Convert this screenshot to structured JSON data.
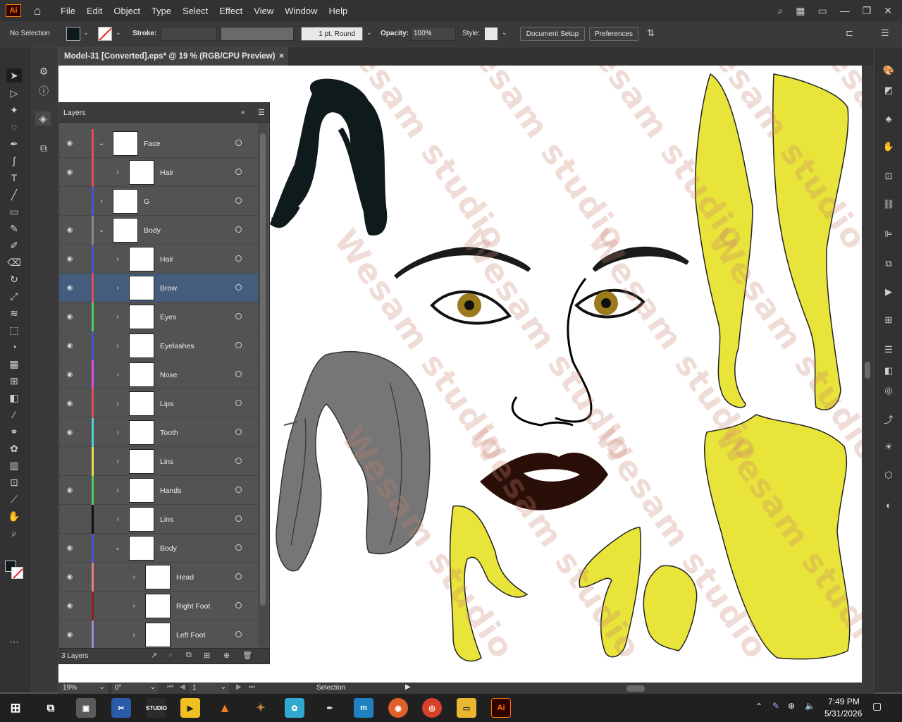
{
  "app": {
    "logo": "Ai",
    "menus": [
      "File",
      "Edit",
      "Object",
      "Type",
      "Select",
      "Effect",
      "View",
      "Window",
      "Help"
    ]
  },
  "controlbar": {
    "selection_status": "No Selection",
    "stroke_label": "Stroke:",
    "stroke_profile": "1 pt. Round",
    "opacity_label": "Opacity:",
    "opacity_value": "100%",
    "style_label": "Style:",
    "document_setup": "Document Setup",
    "preferences": "Preferences"
  },
  "document": {
    "tab_title": "Model-31 [Converted].eps* @ 19 % (RGB/CPU Preview)",
    "close_symbol": "×"
  },
  "layers_panel": {
    "title": "Layers",
    "footer_count": "3 Layers",
    "rows": [
      {
        "name": "Face",
        "color": "#e05050",
        "indent": 0,
        "expanded": true,
        "visible": true,
        "selected": false
      },
      {
        "name": "Hair",
        "color": "#e05050",
        "indent": 1,
        "expanded": false,
        "visible": true,
        "selected": false
      },
      {
        "name": "G",
        "color": "#5050d0",
        "indent": 0,
        "expanded": false,
        "visible": false,
        "selected": false
      },
      {
        "name": "Body",
        "color": "#888888",
        "indent": 0,
        "expanded": true,
        "visible": true,
        "selected": false
      },
      {
        "name": "Hair",
        "color": "#5050d0",
        "indent": 1,
        "expanded": false,
        "visible": true,
        "selected": false
      },
      {
        "name": "Brow",
        "color": "#e05050",
        "indent": 1,
        "expanded": false,
        "visible": true,
        "selected": true
      },
      {
        "name": "Eyes",
        "color": "#50d050",
        "indent": 1,
        "expanded": false,
        "visible": true,
        "selected": false
      },
      {
        "name": "Eyelashes",
        "color": "#5050d0",
        "indent": 1,
        "expanded": false,
        "visible": true,
        "selected": false
      },
      {
        "name": "Nose",
        "color": "#e050e0",
        "indent": 1,
        "expanded": false,
        "visible": true,
        "selected": false
      },
      {
        "name": "Lips",
        "color": "#e05050",
        "indent": 1,
        "expanded": false,
        "visible": true,
        "selected": false
      },
      {
        "name": "Tooth",
        "color": "#50d0d0",
        "indent": 1,
        "expanded": false,
        "visible": true,
        "selected": false
      },
      {
        "name": "Lins",
        "color": "#e0e050",
        "indent": 1,
        "expanded": false,
        "visible": false,
        "selected": false
      },
      {
        "name": "Hands",
        "color": "#50d050",
        "indent": 1,
        "expanded": false,
        "visible": true,
        "selected": false
      },
      {
        "name": "Lins",
        "color": "#111111",
        "indent": 1,
        "expanded": false,
        "visible": false,
        "selected": false
      },
      {
        "name": "Body",
        "color": "#5050d0",
        "indent": 1,
        "expanded": true,
        "visible": true,
        "selected": false
      },
      {
        "name": "Head",
        "color": "#e08080",
        "indent": 2,
        "expanded": false,
        "visible": true,
        "selected": false
      },
      {
        "name": "Right Foot",
        "color": "#902020",
        "indent": 2,
        "expanded": false,
        "visible": true,
        "selected": false
      },
      {
        "name": "Left Foot",
        "color": "#9090e0",
        "indent": 2,
        "expanded": false,
        "visible": true,
        "selected": false
      }
    ]
  },
  "statusbar": {
    "zoom": "19%",
    "rotation": "0°",
    "artboard": "1",
    "tool": "Selection"
  },
  "watermark": {
    "text": "Wesam studio"
  },
  "taskbar": {
    "time": "7:49 PM",
    "date": "5/31/2026"
  },
  "colors": {
    "skin": "#e8e43a",
    "hair": "#0e1a1c",
    "lips": "#2a0f08",
    "selection": "#455d7d"
  }
}
